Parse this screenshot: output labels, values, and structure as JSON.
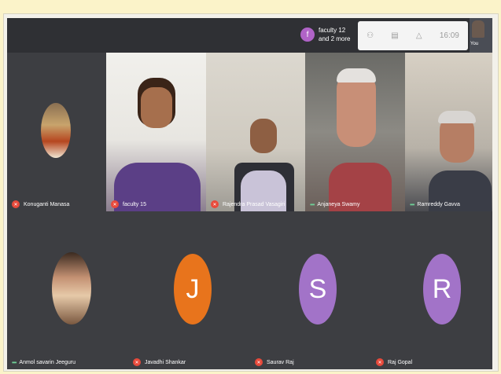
{
  "topbar": {
    "others_initial": "f",
    "others_line1": "faculty 12",
    "others_line2": "and 2 more",
    "clock": "16:09",
    "self_label": "You",
    "people_icon": "people-icon",
    "chat_icon": "chat-icon",
    "activities_icon": "activities-icon"
  },
  "participants": [
    {
      "name": "Konuganti Manasa",
      "status": "muted"
    },
    {
      "name": "faculty 15",
      "status": "muted"
    },
    {
      "name": "Rajendra Prasad Vasagiri",
      "status": "muted"
    },
    {
      "name": "Anjaneya Swamy",
      "status": "speaking"
    },
    {
      "name": "Ramreddy Gavva",
      "status": "speaking"
    },
    {
      "name": "Anmol savarin Jeeguru",
      "status": "speaking"
    },
    {
      "name": "Javadhi Shankar",
      "initial": "J",
      "status": "muted"
    },
    {
      "name": "Saurav Raj",
      "initial": "S",
      "status": "muted"
    },
    {
      "name": "Raj Gopal",
      "initial": "R",
      "status": "muted"
    }
  ],
  "colors": {
    "background": "#3d3e42",
    "orange_avatar": "#e8741c",
    "purple_avatar": "#a273c8",
    "mic_muted": "#e84a3b"
  }
}
